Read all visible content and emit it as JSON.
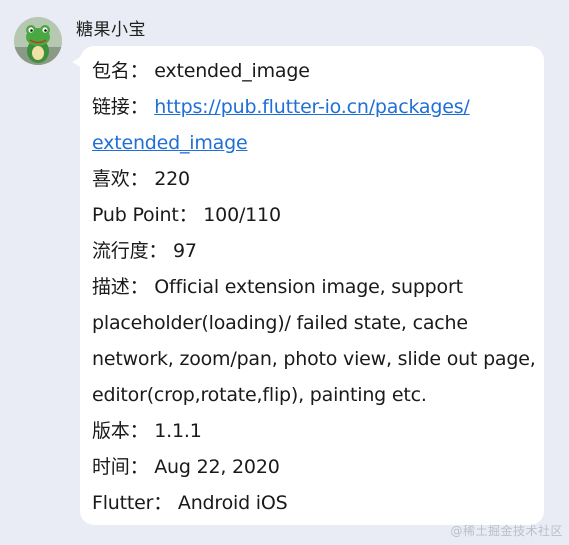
{
  "chat": {
    "sender_name": "糖果小宝",
    "watermark": "@稀土掘金技术社区"
  },
  "message": {
    "package_label": "包名：",
    "package_value": "extended_image",
    "link_label": "链接：",
    "link_line1": "https://pub.flutter-io.cn/packages/",
    "link_line2": "extended_image",
    "likes_label": "喜欢：",
    "likes_value": "220",
    "pub_label": "Pub Point：",
    "pub_value": "100/110",
    "popularity_label": "流行度：",
    "popularity_value": "97",
    "desc_label": "描述：",
    "desc_line1": "Official extension image, support",
    "desc_line2": "placeholder(loading)/ failed state, cache",
    "desc_line3": "network, zoom/pan, photo view, slide out page,",
    "desc_line4": "editor(crop,rotate,flip), painting etc.",
    "version_label": "版本：",
    "version_value": "1.1.1",
    "time_label": "时间：",
    "time_value": "Aug 22, 2020",
    "flutter_label": "Flutter：",
    "flutter_value": "Android iOS"
  }
}
